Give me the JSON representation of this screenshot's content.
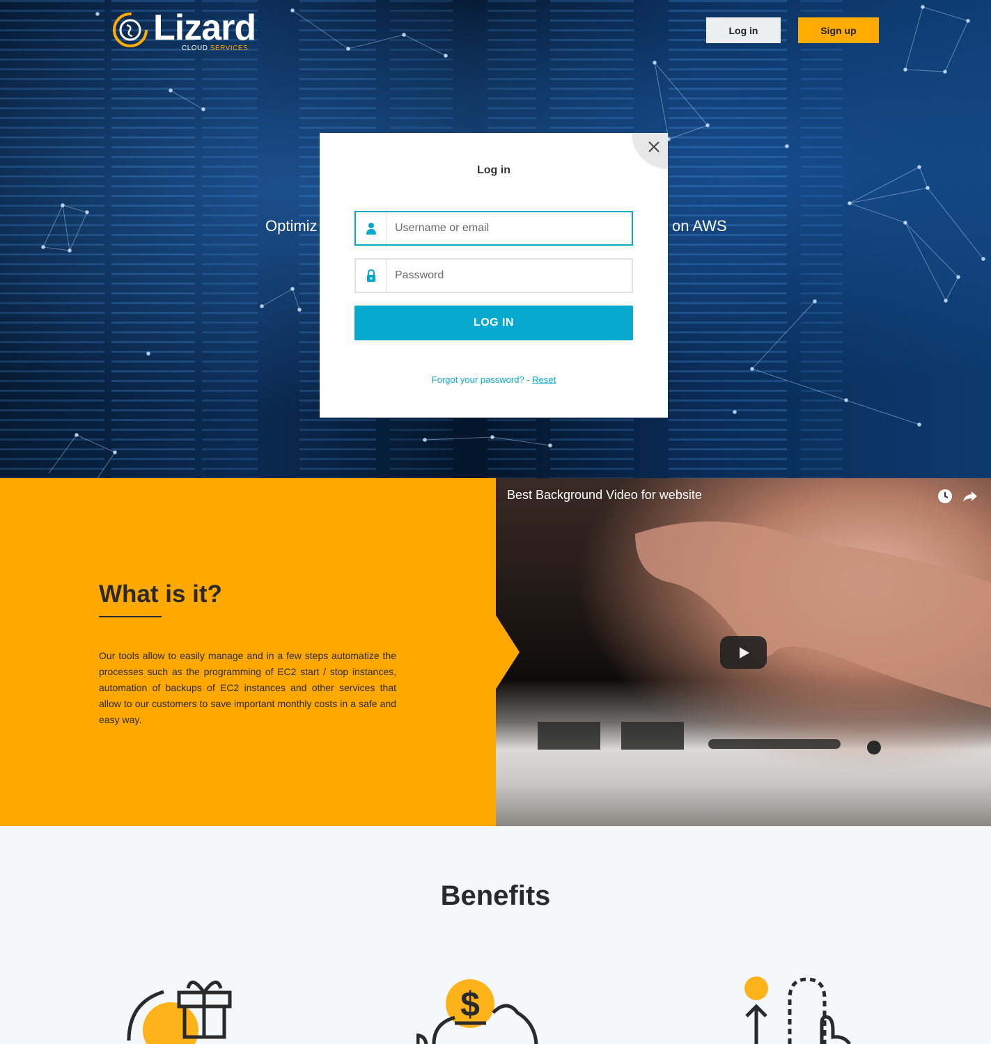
{
  "brand": {
    "name": "Lizard",
    "sub_1": "CLOUD",
    "sub_2": "SERVICES"
  },
  "nav": {
    "login_label": "Log in",
    "signup_label": "Sign up"
  },
  "hero": {
    "tagline_left": "Optimiz",
    "tagline_right": "on AWS"
  },
  "modal": {
    "title": "Log in",
    "username_placeholder": "Username or email",
    "password_placeholder": "Password",
    "submit_label": "LOG IN",
    "forgot_text": "Forgot your password? - ",
    "reset_label": "Reset"
  },
  "what": {
    "title": "What is it?",
    "body": "Our tools allow to easily manage and in a few steps automatize the processes such as the programming of EC2 start / stop instances, automation of backups of EC2 instances and other services that allow to our customers to save important monthly costs in a safe and easy way."
  },
  "video": {
    "title": "Best Background Video for website",
    "icons": [
      "clock-icon",
      "share-icon",
      "play-icon"
    ]
  },
  "benefits": {
    "title": "Benefits",
    "icons": [
      "gift-icon",
      "piggy-bank-icon",
      "touch-icon"
    ]
  },
  "colors": {
    "accent": "#ffa800",
    "primary": "#07a9cf",
    "dark": "#2a2a2a"
  }
}
